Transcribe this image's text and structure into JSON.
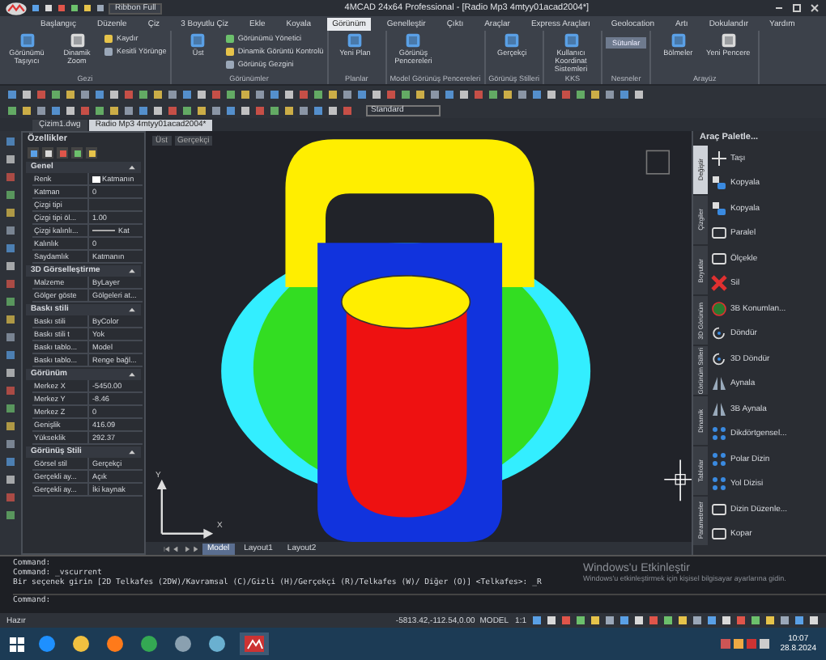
{
  "window": {
    "title": "4MCAD 24x64 Professional - [Radio Mp3 4mtyy01acad2004*]",
    "workspace": "Ribbon Full"
  },
  "ribbon_tabs": [
    {
      "label": "Başlangıç",
      "selected": false
    },
    {
      "label": "Düzenle",
      "selected": false
    },
    {
      "label": "Çiz",
      "selected": false
    },
    {
      "label": "3 Boyutlu Çiz",
      "selected": false
    },
    {
      "label": "Ekle",
      "selected": false
    },
    {
      "label": "Koyala",
      "selected": false
    },
    {
      "label": "Görünüm",
      "selected": true
    },
    {
      "label": "Genelleştir",
      "selected": false
    },
    {
      "label": "Çıktı",
      "selected": false
    },
    {
      "label": "Araçlar",
      "selected": false
    },
    {
      "label": "Express Araçları",
      "selected": false
    },
    {
      "label": "Geolocation",
      "selected": false
    },
    {
      "label": "Artı",
      "selected": false
    },
    {
      "label": "Dokulandır",
      "selected": false
    },
    {
      "label": "Yardım",
      "selected": false
    }
  ],
  "ribbon_panels": [
    {
      "title": "Gezi",
      "items": [
        {
          "kind": "large",
          "label": "Görünümü Taşıyıcı"
        },
        {
          "kind": "large",
          "label": "Dinamik Zoom"
        },
        {
          "kind": "small",
          "label": "Kaydır"
        },
        {
          "kind": "small",
          "label": "Kesitli Yörünge"
        }
      ]
    },
    {
      "title": "Görünümler",
      "items": [
        {
          "kind": "large",
          "label": "Üst"
        },
        {
          "kind": "small",
          "label": "Görünümü Yönetici"
        },
        {
          "kind": "small",
          "label": "Dinamik Görüntü Kontrolü"
        },
        {
          "kind": "small",
          "label": "Görünüş Gezgini"
        }
      ]
    },
    {
      "title": "Planlar",
      "items": [
        {
          "kind": "large",
          "label": "Yeni Plan"
        }
      ]
    },
    {
      "title": "Model Görünüş Pencereleri",
      "items": [
        {
          "kind": "large",
          "label": "Görünüş Pencereleri"
        }
      ]
    },
    {
      "title": "Görünüş Stilleri",
      "items": [
        {
          "kind": "large",
          "label": "Gerçekçi"
        }
      ]
    },
    {
      "title": "KKS",
      "items": [
        {
          "kind": "large",
          "label": "Kullanıcı Koordinat Sistemleri"
        }
      ]
    },
    {
      "title": "Nesneler",
      "items": [
        {
          "kind": "field",
          "label": "Sütunlar"
        }
      ]
    },
    {
      "title": "Arayüz",
      "items": [
        {
          "kind": "large",
          "label": "Bölmeler"
        },
        {
          "kind": "large",
          "label": "Yeni Pencere"
        }
      ]
    }
  ],
  "toolbar": {
    "style": "Standard"
  },
  "document_tabs": [
    {
      "label": "Çizim1.dwg",
      "selected": false
    },
    {
      "label": "Radio Mp3 4mtyy01acad2004*",
      "selected": true
    }
  ],
  "properties": {
    "title": "Özellikler",
    "sections": [
      {
        "title": "Genel",
        "expanded": true,
        "rows": [
          {
            "kind": "color",
            "name": "Renk",
            "value": "Katmanın"
          },
          {
            "kind": "text",
            "name": "Katman",
            "value": "0"
          },
          {
            "kind": "empty",
            "name": "Çizgi tipi"
          },
          {
            "kind": "text",
            "name": "Çizgi tipi öl...",
            "value": "1.00"
          },
          {
            "kind": "line",
            "name": "Çizgi kalınlı...",
            "value": "Kat"
          },
          {
            "kind": "text",
            "name": "Kalınlık",
            "value": "0"
          },
          {
            "kind": "text",
            "name": "Saydamlık",
            "value": "Katmanın"
          }
        ]
      },
      {
        "title": "3D Görselleştirme",
        "expanded": true,
        "rows": [
          {
            "kind": "text",
            "name": "Malzeme",
            "value": "ByLayer"
          },
          {
            "kind": "text",
            "name": "Gölger göste",
            "value": "Gölgeleri at..."
          }
        ]
      },
      {
        "title": "Baskı stili",
        "expanded": true,
        "rows": [
          {
            "kind": "text",
            "name": "Baskı stili",
            "value": "ByColor"
          },
          {
            "kind": "text",
            "name": "Baskı stili t",
            "value": "Yok"
          },
          {
            "kind": "text",
            "name": "Baskı tablo...",
            "value": "Model"
          },
          {
            "kind": "text",
            "name": "Baskı tablo...",
            "value": "Renge bağl..."
          }
        ]
      },
      {
        "title": "Görünüm",
        "expanded": true,
        "rows": [
          {
            "kind": "text",
            "name": "Merkez X",
            "value": "-5450.00"
          },
          {
            "kind": "text",
            "name": "Merkez Y",
            "value": "-8.46"
          },
          {
            "kind": "text",
            "name": "Merkez Z",
            "value": "0"
          },
          {
            "kind": "text",
            "name": "Genişlik",
            "value": "416.09"
          },
          {
            "kind": "text",
            "name": "Yükseklik",
            "value": "292.37"
          }
        ]
      },
      {
        "title": "Görünüş Stili",
        "expanded": true,
        "rows": [
          {
            "kind": "text",
            "name": "Görsel stil",
            "value": "Gerçekçi"
          },
          {
            "kind": "text",
            "name": "Gerçekli ay...",
            "value": "Açık"
          },
          {
            "kind": "text",
            "name": "Gerçekli ay...",
            "value": "İki kaynak"
          }
        ]
      }
    ]
  },
  "viewport": {
    "view": "Üst",
    "style": "Gerçekçi",
    "axis_x": "X",
    "axis_y": "Y"
  },
  "layout_tabs": [
    {
      "label": "Model",
      "selected": true
    },
    {
      "label": "Layout1",
      "selected": false
    },
    {
      "label": "Layout2",
      "selected": false
    }
  ],
  "tool_palette": {
    "title": "Araç Paletle...",
    "tabs": [
      {
        "label": "Değiştir",
        "selected": true
      },
      {
        "label": "Çizgiler",
        "selected": false
      },
      {
        "label": "Boyutlar",
        "selected": false
      },
      {
        "label": "3D Görünüm",
        "selected": false
      },
      {
        "label": "Görünüm Stilleri",
        "selected": false
      },
      {
        "label": "Dinamik",
        "selected": false
      },
      {
        "label": "Tablolar",
        "selected": false
      },
      {
        "label": "Parametreler",
        "selected": false
      }
    ],
    "items": [
      {
        "kind": "move",
        "label": "Taşı"
      },
      {
        "kind": "copy",
        "label": "Kopyala"
      },
      {
        "kind": "copy2",
        "label": "Kopyala"
      },
      {
        "kind": "offset",
        "label": "Paralel"
      },
      {
        "kind": "scale",
        "label": "Ölçekle"
      },
      {
        "kind": "erase",
        "label": "Sil"
      },
      {
        "kind": "align",
        "label": "3B Konumlan..."
      },
      {
        "kind": "rotate",
        "label": "Döndür"
      },
      {
        "kind": "rotate",
        "label": "3D Döndür"
      },
      {
        "kind": "mirror",
        "label": "Aynala"
      },
      {
        "kind": "mirror3d",
        "label": "3B Aynala"
      },
      {
        "kind": "grid",
        "label": "Dikdörtgensel..."
      },
      {
        "kind": "polar",
        "label": "Polar Dizin"
      },
      {
        "kind": "path",
        "label": "Yol Dizisi"
      },
      {
        "kind": "edit",
        "label": "Dizin Düzenle..."
      },
      {
        "kind": "break",
        "label": "Kopar"
      }
    ]
  },
  "command_line": {
    "history": [
      "Command:",
      "Command: _vscurrent",
      "Bir seçenek girin [2D Telkafes (2DW)/Kavramsal (C)/Gizli (H)/Gerçekçi (R)/Telkafes (W)/ Diğer (O)] <Telkafes>: _R"
    ],
    "prompt": "Command:"
  },
  "activation": {
    "title": "Windows'u Etkinleştir",
    "text": "Windows'u etkinleştirmek için kişisel bilgisayar ayarlarına gidin."
  },
  "status_bar": {
    "state": "Hazır",
    "coordinates": "-5813.42,-112.54,0.00",
    "space": "MODEL",
    "scale": "1:1"
  },
  "taskbar": {
    "time": "10:07",
    "date": "28.8.2024"
  }
}
